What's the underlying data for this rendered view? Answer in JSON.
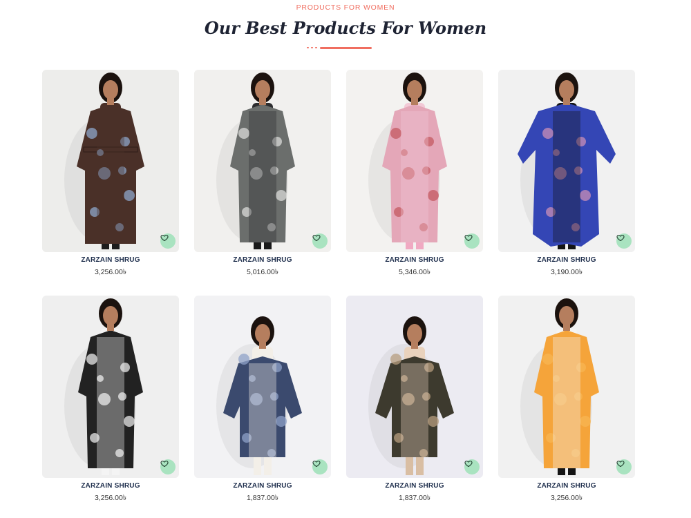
{
  "section": {
    "eyebrow": "PRODUCTS FOR WOMEN",
    "title": "Our Best Products For Women",
    "accent_color": "#f06e60"
  },
  "wishlist": {
    "icon": "heart-outline-icon",
    "badge_color": "#a9e3c0"
  },
  "products": [
    {
      "name": "ZARZAIN SHRUG",
      "price": "3,256.00৳",
      "bg": "#ededeb",
      "garment": "#4a3028",
      "pattern": "#8ea5c9",
      "inner": "#4a3028",
      "legs": "#1c1c1c",
      "style": "long-belted"
    },
    {
      "name": "ZARZAIN SHRUG",
      "price": "5,016.00৳",
      "bg": "#f1f0ee",
      "garment": "#6b6e6c",
      "pattern": "#d9dbd8",
      "inner": "#2c2c2e",
      "legs": "#1a1a1a",
      "style": "long"
    },
    {
      "name": "ZARZAIN SHRUG",
      "price": "5,346.00৳",
      "bg": "#f3f2f0",
      "garment": "#e4a7b8",
      "pattern": "#c45a62",
      "inner": "#f2c9d6",
      "legs": "#f0a9c2",
      "style": "long"
    },
    {
      "name": "ZARZAIN SHRUG",
      "price": "3,190.00৳",
      "bg": "#f1f1f1",
      "garment": "#3446b5",
      "pattern": "#c98fb7",
      "inner": "#141414",
      "legs": "#141414",
      "style": "wide"
    },
    {
      "name": "ZARZAIN SHRUG",
      "price": "3,256.00৳",
      "bg": "#efefef",
      "garment": "#222222",
      "pattern": "#e8e8e8",
      "inner": "#f4f4f4",
      "legs": "#f4f4f4",
      "style": "long"
    },
    {
      "name": "ZARZAIN SHRUG",
      "price": "1,837.00৳",
      "bg": "#f2f2f4",
      "garment": "#3b4a6e",
      "pattern": "#8fa1c8",
      "inner": "#f3efe8",
      "legs": "#f3efe8",
      "style": "short"
    },
    {
      "name": "ZARZAIN SHRUG",
      "price": "1,837.00৳",
      "bg": "#ecebf2",
      "garment": "#3d3a2e",
      "pattern": "#b79d7f",
      "inner": "#e9d2bd",
      "legs": "#d9bea3",
      "style": "short"
    },
    {
      "name": "ZARZAIN SHRUG",
      "price": "3,256.00৳",
      "bg": "#f1f1f1",
      "garment": "#f5a43a",
      "pattern": "#f7b653",
      "inner": "#f4f4f4",
      "legs": "#141414",
      "style": "long"
    }
  ]
}
